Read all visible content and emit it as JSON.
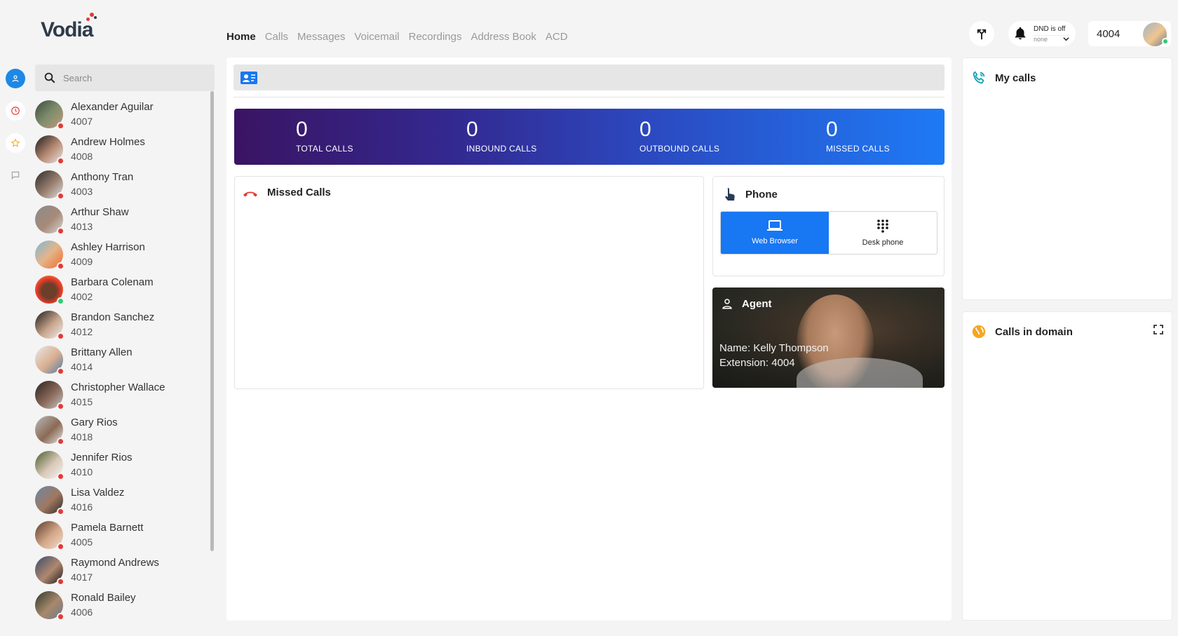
{
  "brand": {
    "name": "Vodia"
  },
  "nav": {
    "tabs": [
      {
        "label": "Home",
        "active": true
      },
      {
        "label": "Calls"
      },
      {
        "label": "Messages"
      },
      {
        "label": "Voicemail"
      },
      {
        "label": "Recordings"
      },
      {
        "label": "Address Book"
      },
      {
        "label": "ACD"
      }
    ]
  },
  "header": {
    "dnd_title": "DND is off",
    "dnd_select": "none",
    "extension": "4004"
  },
  "search": {
    "placeholder": "Search"
  },
  "contacts": [
    {
      "name": "Alexander Aguilar",
      "ext": "4007",
      "status": "offline"
    },
    {
      "name": "Andrew Holmes",
      "ext": "4008",
      "status": "offline"
    },
    {
      "name": "Anthony Tran",
      "ext": "4003",
      "status": "offline"
    },
    {
      "name": "Arthur Shaw",
      "ext": "4013",
      "status": "offline"
    },
    {
      "name": "Ashley Harrison",
      "ext": "4009",
      "status": "offline"
    },
    {
      "name": "Barbara Colenam",
      "ext": "4002",
      "status": "online"
    },
    {
      "name": "Brandon Sanchez",
      "ext": "4012",
      "status": "offline"
    },
    {
      "name": "Brittany Allen",
      "ext": "4014",
      "status": "offline"
    },
    {
      "name": "Christopher Wallace",
      "ext": "4015",
      "status": "offline"
    },
    {
      "name": "Gary Rios",
      "ext": "4018",
      "status": "offline"
    },
    {
      "name": "Jennifer Rios",
      "ext": "4010",
      "status": "offline"
    },
    {
      "name": "Lisa Valdez",
      "ext": "4016",
      "status": "offline"
    },
    {
      "name": "Pamela Barnett",
      "ext": "4005",
      "status": "offline"
    },
    {
      "name": "Raymond Andrews",
      "ext": "4017",
      "status": "offline"
    },
    {
      "name": "Ronald Bailey",
      "ext": "4006",
      "status": "offline"
    }
  ],
  "stats": [
    {
      "value": "0",
      "label": "TOTAL CALLS"
    },
    {
      "value": "0",
      "label": "INBOUND CALLS"
    },
    {
      "value": "0",
      "label": "OUTBOUND CALLS"
    },
    {
      "value": "0",
      "label": "MISSED CALLS"
    }
  ],
  "missed_calls": {
    "title": "Missed Calls"
  },
  "phone": {
    "title": "Phone",
    "options": [
      {
        "label": "Web Browser",
        "icon": "laptop-icon",
        "active": true
      },
      {
        "label": "Desk phone",
        "icon": "dialpad-icon",
        "active": false
      }
    ]
  },
  "agent": {
    "title": "Agent",
    "name_line": "Name: Kelly Thompson",
    "ext_line": "Extension: 4004"
  },
  "my_calls": {
    "title": "My calls"
  },
  "calls_in_domain": {
    "title": "Calls in domain"
  },
  "colors": {
    "accent": "#1877f2",
    "status_offline": "#e53935",
    "status_online": "#2ecc71",
    "missed_icon": "#e53935",
    "domain_icon": "#f5a623"
  }
}
